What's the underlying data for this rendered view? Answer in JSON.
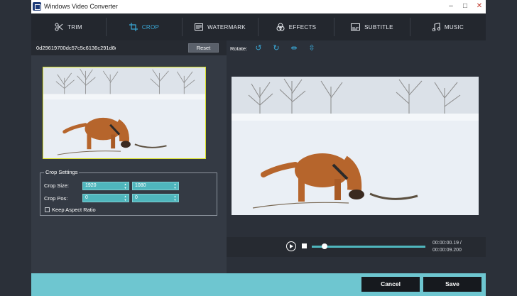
{
  "window": {
    "title": "Windows Video Converter",
    "minimize": "–",
    "maximize": "□",
    "close": "✕"
  },
  "tabs": [
    {
      "label": "TRIM",
      "icon": "scissors-icon"
    },
    {
      "label": "CROP",
      "icon": "crop-icon",
      "active": true
    },
    {
      "label": "WATERMARK",
      "icon": "watermark-icon"
    },
    {
      "label": "EFFECTS",
      "icon": "effects-icon"
    },
    {
      "label": "SUBTITLE",
      "icon": "subtitle-icon"
    },
    {
      "label": "MUSIC",
      "icon": "music-icon"
    }
  ],
  "file": {
    "name": "0d29619700dc57c5c6136c291d8d",
    "reset_label": "Reset"
  },
  "crop_settings": {
    "legend": "Crop Settings",
    "size_label": "Crop Size:",
    "width": "1920",
    "height": "1080",
    "pos_label": "Crop Pos:",
    "pos_x": "0",
    "pos_y": "0",
    "keep_aspect_label": "Keep Aspect Ratio",
    "keep_aspect_checked": false
  },
  "rotate": {
    "label": "Rotate:",
    "icons": [
      "rotate-left-icon",
      "rotate-right-icon",
      "flip-horizontal-icon",
      "flip-vertical-icon"
    ]
  },
  "player": {
    "current_time": "00:00:00.19 /",
    "total_time": "00:00:09.200",
    "progress": 0.1
  },
  "footer": {
    "cancel_label": "Cancel",
    "save_label": "Save"
  },
  "colors": {
    "accent": "#3aa9d8",
    "teal": "#4fb6bd",
    "footer": "#6ec6d0",
    "crop_border": "#d9e022"
  }
}
